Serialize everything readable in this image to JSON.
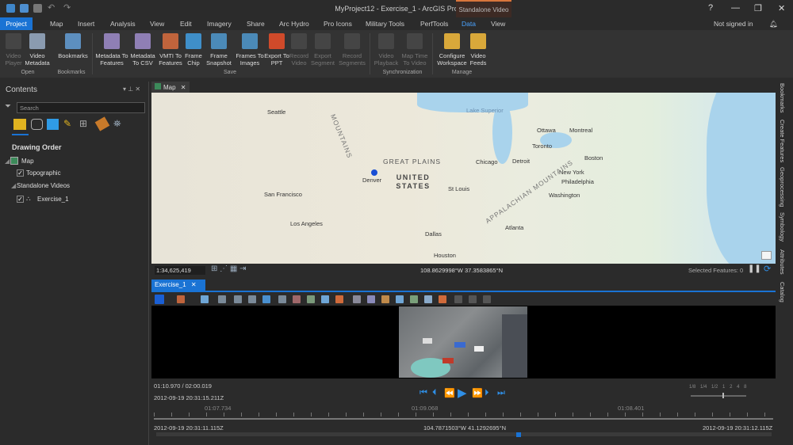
{
  "window": {
    "title": "MyProject12 - Exercise_1 - ArcGIS Pro",
    "context_tab_group": "Standalone Video",
    "help": "?",
    "minimize": "—",
    "restore": "❐",
    "close": "✕",
    "sign_in": "Not signed in",
    "colors": {
      "accent": "#1a73d4",
      "context": "#d9763c"
    }
  },
  "tabs": [
    "Project",
    "Map",
    "Insert",
    "Analysis",
    "View",
    "Edit",
    "Imagery",
    "Share",
    "Arc Hydro",
    "Pro Icons",
    "Military Tools",
    "PerfTools",
    "Data",
    "View"
  ],
  "ribbon": {
    "buttons": [
      {
        "label": "Video Player",
        "enabled": false
      },
      {
        "label": "Video Metadata",
        "enabled": true
      },
      {
        "label": "Bookmarks",
        "enabled": true
      },
      {
        "label": "Metadata To Features",
        "enabled": true
      },
      {
        "label": "Metadata To CSV",
        "enabled": true
      },
      {
        "label": "VMTI To Features",
        "enabled": true
      },
      {
        "label": "Frame Chip",
        "enabled": true
      },
      {
        "label": "Frame Snapshot",
        "enabled": true
      },
      {
        "label": "Frames To Images",
        "enabled": true
      },
      {
        "label": "Export To PPT",
        "enabled": true
      },
      {
        "label": "Record Video",
        "enabled": false
      },
      {
        "label": "Export Segment",
        "enabled": false
      },
      {
        "label": "Record Segments",
        "enabled": false
      },
      {
        "label": "Video Playback",
        "enabled": false
      },
      {
        "label": "Map Time To Video",
        "enabled": false
      },
      {
        "label": "Configure Workspace",
        "enabled": true
      },
      {
        "label": "Video Feeds",
        "enabled": true
      }
    ],
    "groups": [
      "Open",
      "Bookmarks",
      "Save",
      "Synchronization",
      "Manage"
    ]
  },
  "contents": {
    "title": "Contents",
    "search_placeholder": "Search",
    "heading": "Drawing Order",
    "items": [
      {
        "label": "Map"
      },
      {
        "label": "Topographic",
        "checked": true
      },
      {
        "label": "Standalone Videos"
      },
      {
        "label": "Exercise_1",
        "checked": true
      }
    ]
  },
  "map": {
    "tab": "Map",
    "scale": "1:34,625,419",
    "coords": "108.8629998°W 37.3583865°N",
    "selected_features": "Selected Features: 0",
    "labels": {
      "seattle": "Seattle",
      "lake_superior": "Lake Superior",
      "ottawa": "Ottawa",
      "montreal": "Montreal",
      "toronto": "Toronto",
      "boston": "Boston",
      "detroit": "Detroit",
      "chicago": "Chicago",
      "new_york": "New York",
      "philadelphia": "Philadelphia",
      "washington": "Washington",
      "great_plains": "GREAT PLAINS",
      "united_states": "UNITED STATES",
      "denver": "Denver",
      "st_louis": "St Louis",
      "san_francisco": "San Francisco",
      "los_angeles": "Los Angeles",
      "dallas": "Dallas",
      "atlanta": "Atlanta",
      "houston": "Houston",
      "rocky": "MOUNTAINS",
      "appalachian": "APPALACHIAN MOUNTAINS"
    }
  },
  "video": {
    "tab": "Exercise_1",
    "elapsed": "01:10.970 / 02:00.019",
    "current_time": "2012-09-19 20:31:15.211Z",
    "ticks": [
      "01:07.734",
      "01:09.068",
      "01:08.401"
    ],
    "start_time": "2012-09-19 20:31:11.115Z",
    "end_time": "2012-09-19 20:31:12.115Z",
    "frame_coords": "104.7871503°W 41.1292695°N",
    "speeds": [
      "1/8",
      "1/4",
      "1/2",
      "1",
      "2",
      "4",
      "8"
    ],
    "progress": 0.59
  },
  "side_panes": [
    "Bookmarks",
    "Create Features",
    "Geoprocessing",
    "Symbology",
    "Attributes",
    "Catalog"
  ]
}
